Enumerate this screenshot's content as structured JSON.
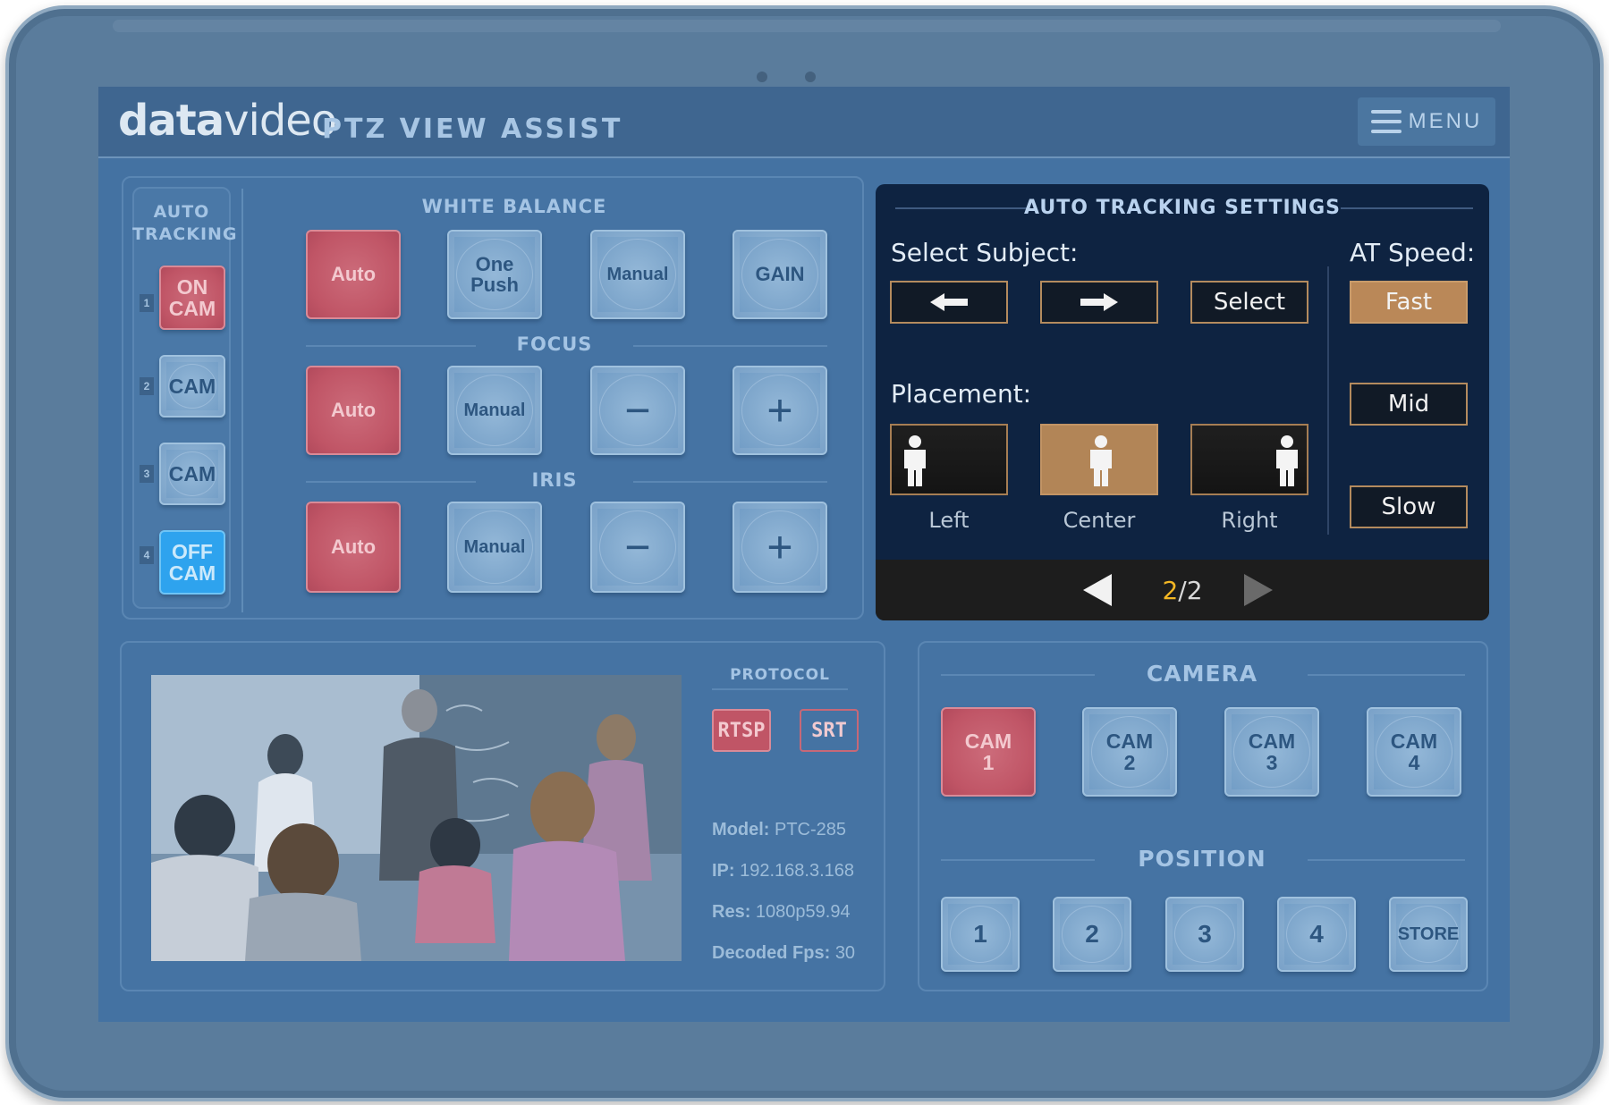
{
  "header": {
    "logo_bold": "data",
    "logo_light": "video",
    "title": "PTZ VIEW ASSIST",
    "menu_label": "MENU"
  },
  "auto_tracking": {
    "title_line1": "AUTO",
    "title_line2": "TRACKING",
    "cams": [
      {
        "num": "1",
        "line1": "ON",
        "line2": "CAM",
        "state": "on"
      },
      {
        "num": "2",
        "line1": "CAM",
        "line2": "",
        "state": "idle"
      },
      {
        "num": "3",
        "line1": "CAM",
        "line2": "",
        "state": "idle"
      },
      {
        "num": "4",
        "line1": "OFF",
        "line2": "CAM",
        "state": "off"
      }
    ]
  },
  "white_balance": {
    "label": "WHITE BALANCE",
    "buttons": [
      {
        "line1": "Auto",
        "line2": ""
      },
      {
        "line1": "One",
        "line2": "Push"
      },
      {
        "line1": "Manual",
        "line2": ""
      },
      {
        "line1": "GAIN",
        "line2": ""
      }
    ]
  },
  "focus": {
    "label": "FOCUS",
    "auto": "Auto",
    "manual": "Manual",
    "minus": "−",
    "plus": "+"
  },
  "iris": {
    "label": "IRIS",
    "auto": "Auto",
    "manual": "Manual",
    "minus": "−",
    "plus": "+"
  },
  "at_settings": {
    "title": "AUTO TRACKING SETTINGS",
    "select_subject": "Select Subject:",
    "select_label": "Select",
    "at_speed": "AT Speed:",
    "speeds": [
      "Fast",
      "Mid",
      "Slow"
    ],
    "active_speed": "Fast",
    "placement": "Placement:",
    "placements": [
      "Left",
      "Center",
      "Right"
    ],
    "active_placement": "Center",
    "page_current": "2",
    "page_total": "/2"
  },
  "stream": {
    "protocol_label": "PROTOCOL",
    "protocols": [
      "RTSP",
      "SRT"
    ],
    "active_protocol": "RTSP",
    "info": [
      {
        "key": "Model:",
        "value": "PTC-285"
      },
      {
        "key": "IP:",
        "value": "192.168.3.168"
      },
      {
        "key": "Res:",
        "value": "1080p59.94"
      },
      {
        "key": "Decoded Fps:",
        "value": "30"
      }
    ]
  },
  "camera": {
    "label": "CAMERA",
    "cams": [
      {
        "line1": "CAM",
        "line2": "1"
      },
      {
        "line1": "CAM",
        "line2": "2"
      },
      {
        "line1": "CAM",
        "line2": "3"
      },
      {
        "line1": "CAM",
        "line2": "4"
      }
    ],
    "active": "1"
  },
  "position": {
    "label": "POSITION",
    "buttons": [
      "1",
      "2",
      "3",
      "4",
      "STORE"
    ]
  },
  "colors": {
    "screen_bg": "#4472a2",
    "red_button": "#c05566",
    "cyan_button": "#2ea3ee",
    "at_panel_bg": "#0e2341",
    "gold_accent": "#ba8858",
    "page_highlight": "#f2b624"
  }
}
